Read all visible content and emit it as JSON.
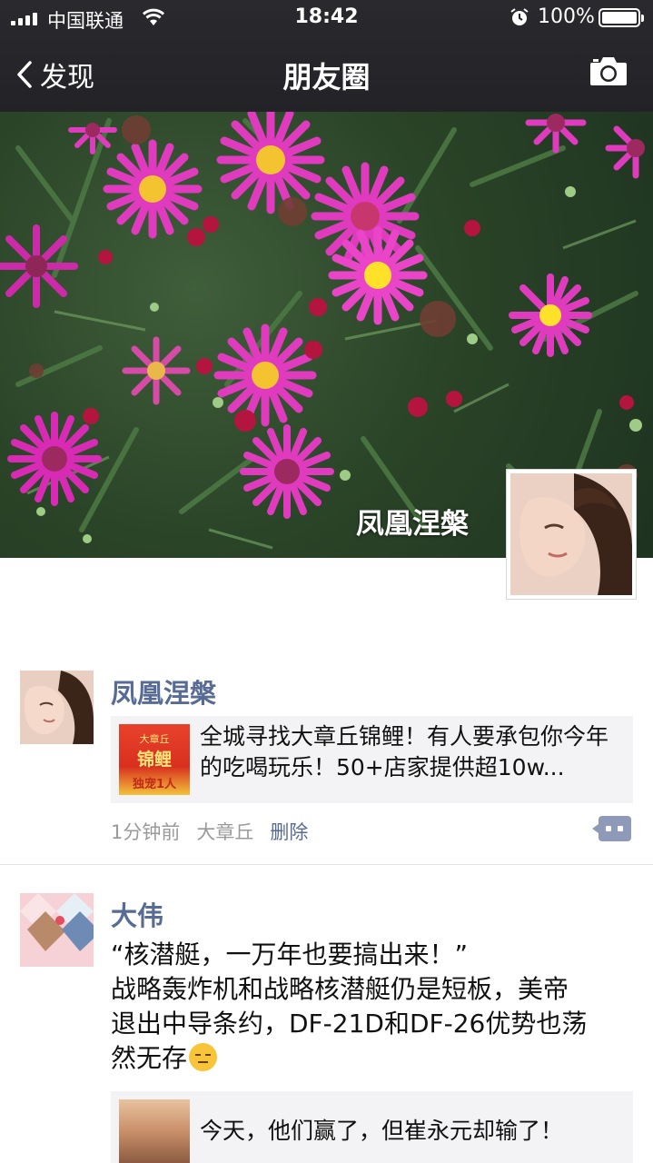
{
  "status_bar": {
    "carrier": "中国联通",
    "time": "18:42",
    "battery_percent": "100%"
  },
  "nav": {
    "back_label": "发现",
    "title": "朋友圈"
  },
  "cover": {
    "display_name": "凤凰涅槃"
  },
  "posts": [
    {
      "username": "凤凰涅槃",
      "share": {
        "thumb_lines": [
          "大章丘",
          "锦鲤",
          "独宠1人"
        ],
        "text": "全城寻找大章丘锦鲤！有人要承包你今年的吃喝玩乐！50+店家提供超10w..."
      },
      "time_ago": "1分钟前",
      "location": "大章丘",
      "delete_label": "删除"
    },
    {
      "username": "大伟",
      "text_lines": [
        "“核潜艇，一万年也要搞出来！”",
        "战略轰炸机和战略核潜艇仍是短板，美帝",
        "退出中导条约，DF-21D和DF-26优势也荡",
        "然无存"
      ],
      "share": {
        "text": "今天，他们赢了，但崔永元却输了！"
      }
    }
  ]
}
